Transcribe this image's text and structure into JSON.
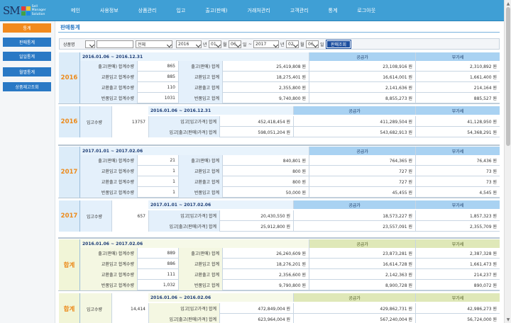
{
  "brand": {
    "logo_main": "SM",
    "logo_sub_1": "Sell",
    "logo_sub_2": "Manager",
    "logo_sub_3": "Solution",
    "square_colors": [
      "#e53935",
      "#fbc02d",
      "#43a047",
      "#1e88e5"
    ]
  },
  "nav": [
    "메인",
    "사용정보",
    "상품관리",
    "입고",
    "출고(판매)",
    "거래처관리",
    "고객관리",
    "통계",
    "로그아웃"
  ],
  "sidebar": [
    "통계",
    "판매통계",
    "일일통계",
    "월별통계",
    "상품재고조회"
  ],
  "page_title": "판매통계",
  "filter": {
    "product_label": "상품명",
    "product_value": "",
    "category_value": "전체",
    "start_year": "2016",
    "year_unit_1": "년",
    "start_month": "01",
    "month_unit_1": "월",
    "start_day": "06",
    "day_unit_1": "일",
    "tilde": "~",
    "end_year": "2017",
    "year_unit_2": "년",
    "end_month": "02",
    "month_unit_2": "월",
    "end_day": "06",
    "day_unit_2": "일",
    "search_label": "판매조회"
  },
  "headers": {
    "supply": "공급가",
    "vat": "부가세"
  },
  "sections": [
    {
      "label": "2016",
      "sales": {
        "range": "2016.01.06 ~ 2016.12.31",
        "rows": [
          {
            "qty_label": "출고(판매) 합계수량",
            "qty": "865",
            "amt_label": "출고(판매) 합계",
            "amount": "25,419,808 원",
            "supply": "23,108,916 원",
            "vat": "2,310,892 원"
          },
          {
            "qty_label": "교환입고 합계수량",
            "qty": "885",
            "amt_label": "교환입고 합계",
            "amount": "18,275,401 원",
            "supply": "16,614,001 원",
            "vat": "1,661,400 원"
          },
          {
            "qty_label": "교환출고 합계수량",
            "qty": "110",
            "amt_label": "교환출고 합계",
            "amount": "2,355,800 원",
            "supply": "2,141,636 원",
            "vat": "214,164 원"
          },
          {
            "qty_label": "반품입고 합계수량",
            "qty": "1031",
            "amt_label": "반품입고 합계",
            "amount": "9,740,800 원",
            "supply": "8,855,273 원",
            "vat": "885,527 원"
          }
        ]
      },
      "stock": {
        "range": "2016.01.06 ~ 2016.12.31",
        "in_label": "입고수량",
        "in_qty": "13757",
        "rows": [
          {
            "label": "입고[입고가격] 합계",
            "amount": "452,418,454 원",
            "supply": "411,289,504 원",
            "vat": "41,128,950 원"
          },
          {
            "label": "입고[출고(판매)가격] 합계",
            "amount": "598,051,204 원",
            "supply": "543,682,913 원",
            "vat": "54,368,291 원"
          }
        ]
      }
    },
    {
      "label": "2017",
      "sales": {
        "range": "2017.01.01 ~ 2017.02.06",
        "rows": [
          {
            "qty_label": "출고(판매) 합계수량",
            "qty": "21",
            "amt_label": "출고(판매) 합계",
            "amount": "840,801 원",
            "supply": "764,365 원",
            "vat": "76,436 원"
          },
          {
            "qty_label": "교환입고 합계수량",
            "qty": "1",
            "amt_label": "교환입고 합계",
            "amount": "800 원",
            "supply": "727 원",
            "vat": "73 원"
          },
          {
            "qty_label": "교환출고 합계수량",
            "qty": "1",
            "amt_label": "교환출고 합계",
            "amount": "800 원",
            "supply": "727 원",
            "vat": "73 원"
          },
          {
            "qty_label": "반품입고 합계수량",
            "qty": "1",
            "amt_label": "반품입고 합계",
            "amount": "50,000 원",
            "supply": "45,455 원",
            "vat": "4,545 원"
          }
        ]
      },
      "stock": {
        "range": "2017.01.01 ~ 2017.02.06",
        "in_label": "입고수량",
        "in_qty": "657",
        "rows": [
          {
            "label": "입고[입고가격] 합계",
            "amount": "20,430,550 원",
            "supply": "18,573,227 원",
            "vat": "1,857,323 원"
          },
          {
            "label": "입고[출고(판매)가격] 합계",
            "amount": "25,912,800 원",
            "supply": "23,557,091 원",
            "vat": "2,355,709 원"
          }
        ]
      }
    },
    {
      "label": "합계",
      "sales": {
        "range": "2016.01.06 ~ 2017.02.06",
        "rows": [
          {
            "qty_label": "출고(판매) 합계수량",
            "qty": "889",
            "amt_label": "출고(판매) 합계",
            "amount": "26,260,609 원",
            "supply": "23,873,281 원",
            "vat": "2,387,328 원"
          },
          {
            "qty_label": "교환입고 합계수량",
            "qty": "886",
            "amt_label": "교환입고 합계",
            "amount": "18,276,201 원",
            "supply": "16,614,728 원",
            "vat": "1,661,473 원"
          },
          {
            "qty_label": "교환출고 합계수량",
            "qty": "111",
            "amt_label": "교환출고 합계",
            "amount": "2,356,600 원",
            "supply": "2,142,363 원",
            "vat": "214,237 원"
          },
          {
            "qty_label": "반품입고 합계수량",
            "qty": "1,032",
            "amt_label": "반품입고 합계",
            "amount": "9,790,800 원",
            "supply": "8,900,728 원",
            "vat": "890,072 원"
          }
        ]
      },
      "stock": {
        "range": "2016.01.06 ~ 2016.02.06",
        "in_label": "입고수량",
        "in_qty": "14,414",
        "rows": [
          {
            "label": "입고[입고가격] 합계",
            "amount": "472,849,004 원",
            "supply": "429,862,731 원",
            "vat": "42,986,273 원"
          },
          {
            "label": "입고[출고(판매)가격] 합계",
            "amount": "623,964,004 원",
            "supply": "567,240,004 원",
            "vat": "56,724,000 원"
          }
        ]
      }
    }
  ]
}
